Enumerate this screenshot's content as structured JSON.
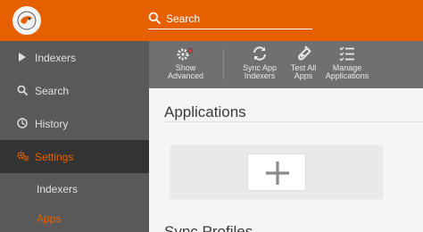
{
  "header": {
    "search_placeholder": "Search"
  },
  "sidebar": {
    "items": [
      {
        "label": "Indexers",
        "icon": "play-icon"
      },
      {
        "label": "Search",
        "icon": "search-icon"
      },
      {
        "label": "History",
        "icon": "history-icon"
      },
      {
        "label": "Settings",
        "icon": "gears-icon"
      }
    ],
    "sub_items": [
      {
        "label": "Indexers"
      },
      {
        "label": "Apps"
      }
    ]
  },
  "toolbar": {
    "buttons": [
      {
        "line1": "Show",
        "line2": "Advanced",
        "icon": "advanced-settings-icon"
      },
      {
        "line1": "Sync App",
        "line2": "Indexers",
        "icon": "sync-icon"
      },
      {
        "line1": "Test All",
        "line2": "Apps",
        "icon": "test-tube-icon"
      },
      {
        "line1": "Manage",
        "line2": "Applications",
        "icon": "list-check-icon"
      }
    ]
  },
  "main": {
    "applications_title": "Applications",
    "sync_profiles_title": "Sync Profiles"
  },
  "colors": {
    "accent": "#e66000",
    "sidebar_bg": "#595959",
    "sidebar_active_bg": "#333333",
    "toolbar_bg": "#707070"
  }
}
